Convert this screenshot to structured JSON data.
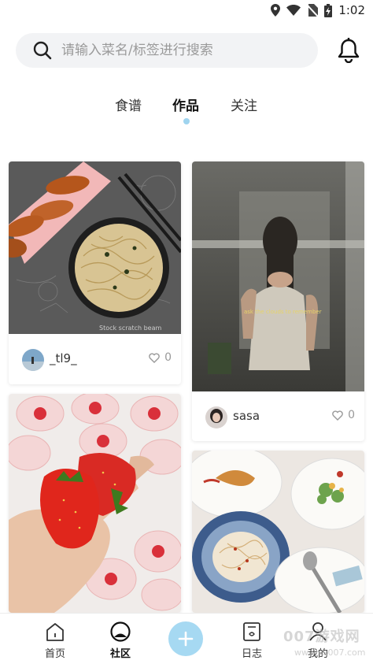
{
  "status_bar": {
    "time": "1:02"
  },
  "search": {
    "placeholder": "请输入菜名/标签进行搜索",
    "value": ""
  },
  "tabs": [
    {
      "label": "食谱",
      "active": false
    },
    {
      "label": "作品",
      "active": true
    },
    {
      "label": "关注",
      "active": false
    }
  ],
  "posts": [
    {
      "username": "_tl9_",
      "likes": "0",
      "image": "noodles-plate-photo",
      "caption": ""
    },
    {
      "username": "sasa",
      "likes": "0",
      "image": "mirror-selfie-photo",
      "caption": "ask the clouds to remember"
    },
    {
      "username": "",
      "likes": "",
      "image": "strawberries-photo",
      "caption": ""
    },
    {
      "username": "",
      "likes": "",
      "image": "pasta-dinner-photo",
      "caption": ""
    }
  ],
  "bottom_nav": {
    "home": "首页",
    "community": "社区",
    "add": "+",
    "diary": "日志",
    "mine": "我的"
  },
  "watermark": {
    "main": "007游戏网",
    "sub": "www.yx007.com"
  },
  "colors": {
    "accent": "#a6d9f2",
    "tab_dot": "#9fd4ef",
    "search_bg": "#f2f3f5"
  }
}
